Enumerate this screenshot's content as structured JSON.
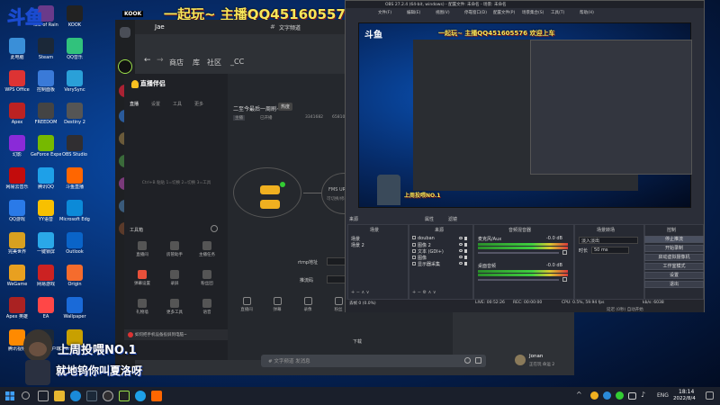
{
  "overlay": {
    "logo": "斗鱼",
    "top_banner": "一起玩~ 主播QQ451605576 欢迎上车",
    "preview_banner": "一起玩~ 主播QQ451605576 欢迎上车",
    "bottom_line1": "上周投喂NO.1",
    "bottom_line2": "就地钨你叫夏洛呀",
    "preview_bottom": "上周投喂NO.1"
  },
  "desktop_icons": [
    {
      "label": "Rufus",
      "color": "#2d6fd0"
    },
    {
      "label": "Isle of Rain",
      "color": "#6a3a8a"
    },
    {
      "label": "KOOK",
      "color": "#222"
    },
    {
      "label": "此电脑",
      "color": "#3a8fd8"
    },
    {
      "label": "Steam",
      "color": "#1b2838"
    },
    {
      "label": "QQ音乐",
      "color": "#31c27c"
    },
    {
      "label": "WPS Office",
      "color": "#d33"
    },
    {
      "label": "控制面板",
      "color": "#3a7ad8"
    },
    {
      "label": "VerySync",
      "color": "#2aa0d8"
    },
    {
      "label": "Apex",
      "color": "#b22"
    },
    {
      "label": "FREEDOM",
      "color": "#444"
    },
    {
      "label": "Destiny 2",
      "color": "#555"
    },
    {
      "label": "幻影",
      "color": "#8a2ad8"
    },
    {
      "label": "GeForce Experience",
      "color": "#76b900"
    },
    {
      "label": "OBS Studio",
      "color": "#302e31"
    },
    {
      "label": "网易云音乐",
      "color": "#c20c0c"
    },
    {
      "label": "腾讯QQ",
      "color": "#1ea0e8"
    },
    {
      "label": "斗鱼直播",
      "color": "#f60"
    },
    {
      "label": "QQ游戏",
      "color": "#2a7ae8"
    },
    {
      "label": "YY语音",
      "color": "#f8c000"
    },
    {
      "label": "Microsoft Edge",
      "color": "#0c8ad8"
    },
    {
      "label": "完美世界",
      "color": "#d8a020"
    },
    {
      "label": "一键锁屏",
      "color": "#2aa8e8"
    },
    {
      "label": "Outlook",
      "color": "#0a64c8"
    },
    {
      "label": "WeGame",
      "color": "#e8a020"
    },
    {
      "label": "网易游戏",
      "color": "#c22"
    },
    {
      "label": "Origin",
      "color": "#f56c2d"
    },
    {
      "label": "Apex 英雄",
      "color": "#a22"
    },
    {
      "label": "EA",
      "color": "#ff4747"
    },
    {
      "label": "Wallpaper",
      "color": "#1a6ad8"
    },
    {
      "label": "腾讯视频",
      "color": "#ff8a00"
    },
    {
      "label": "Steam 客户端",
      "color": "#1b2838"
    },
    {
      "label": "Counter-Strike",
      "color": "#c8a000"
    }
  ],
  "kook": {
    "logo": "KOOK",
    "server": "Jae",
    "channel": "文字频道",
    "nav": [
      "商店",
      "库",
      "社区",
      "_CC"
    ],
    "streamer_app": "直播伴侣",
    "tabs": [
      "直播",
      "设置",
      "工具",
      "更多"
    ],
    "game_title": "二至今最后一周刷~",
    "tag": "热度",
    "stats": [
      "主播",
      "已开播",
      "3341682",
      "65810"
    ],
    "empty_hint": "Ctrl+B 粘贴 1=切换 2=切换 3=工具",
    "bottom_label": "工具箱",
    "fms_label": "FMS URL",
    "fms_sub": "可切换/修改",
    "rtmp_label": "rtmp地址",
    "stream_key_label": "推流码",
    "notification": "如何把手机设备投屏到电脑~",
    "download_label": "下载",
    "chat_placeholder": "# 文字频道 发消息",
    "user_name": "Jonan",
    "user_status": "正在玩 命运 2",
    "side_tools": [
      "直播间",
      "房管助手",
      "主播任务",
      "弹幕设置",
      "录屏",
      "粉丝团",
      "礼物墙",
      "更多工具",
      "语音"
    ],
    "toolbar": [
      "直播间",
      "弹幕",
      "录像",
      "粉丝",
      "礼物",
      "音乐",
      "更多"
    ]
  },
  "obs": {
    "title": "OBS 27.2.4 (64-bit, windows) - 配置文件: 未命名 - 场景: 未命名",
    "menu": [
      "文件(F)",
      "编辑(E)",
      "视图(V)",
      "停靠窗口(D)",
      "配置文件(P)",
      "场景集合(S)",
      "工具(T)",
      "帮助(H)"
    ],
    "panel_labels": [
      "来源",
      "属性",
      "滤镜"
    ],
    "scenes_title": "场景",
    "scenes": [
      "场景",
      "场景 2"
    ],
    "sources_title": "来源",
    "sources": [
      "douban",
      "图像 2",
      "文本 (GDI+)",
      "图像",
      "显示器采集"
    ],
    "mixer_title": "音频混音器",
    "mixer": [
      {
        "name": "麦克风/Aux",
        "db": "-0.0 dB"
      },
      {
        "name": "桌面音频",
        "db": "-0.0 dB"
      }
    ],
    "transitions_title": "场景转场",
    "transition_type": "淡入淡出",
    "duration_label": "时长",
    "duration_value": "50 ms",
    "controls_title": "控制",
    "controls": [
      "停止推流",
      "开始录制",
      "启动虚拟摄像机",
      "工作室模式",
      "设置",
      "退出"
    ],
    "status": {
      "dropped": "丢帧 0 (0.0%)",
      "live": "LIVE: 00:52:26",
      "rec": "REC: 00:00:00",
      "cpu": "CPU: 0.5%, 59.94 fps",
      "bitrate": "kb/s: 6038"
    },
    "bottom_status": "延迟 (0秒) 自动开始"
  },
  "taskbar": {
    "time": "18:14",
    "date": "2022/8/4",
    "lang": "ENG"
  }
}
